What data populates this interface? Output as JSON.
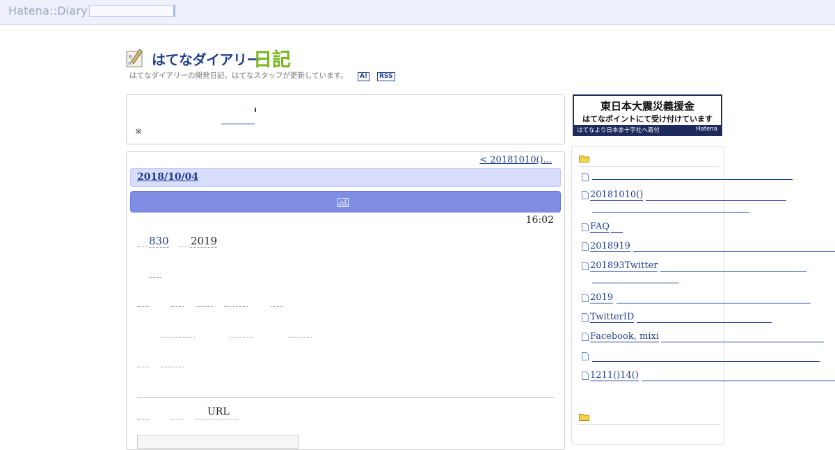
{
  "topbar": {
    "logo": "Hatena::Diary"
  },
  "header": {
    "title": "はてなダイアリー",
    "title_accent": "日記",
    "description": "はてなダイアリーの開発日記。はてなスタッフが更新しています。",
    "badge_a": "A!",
    "badge_rss": "RSS"
  },
  "notice": {
    "mark": "※"
  },
  "main": {
    "prev_link": "< 20181010()...",
    "date": "2018/10/04",
    "time": "16:02",
    "line1_num": "830",
    "line1_year": "2019",
    "url_label": "URL"
  },
  "banner": {
    "line1": "東日本大震災義援金",
    "line2": "はてなポイントにて受け付けています",
    "footer_left": "はてなより日本赤十字社へ寄付",
    "footer_right": "Hatena"
  },
  "sidebar": {
    "items": [
      {
        "label": ""
      },
      {
        "label": "20181010()"
      },
      {
        "label": "FAQ"
      },
      {
        "label": "2018919"
      },
      {
        "label": "201893Twitter"
      },
      {
        "label": "2019"
      },
      {
        "label": "TwitterID"
      },
      {
        "label": "Facebook, mixi"
      },
      {
        "label": ""
      },
      {
        "label": "1211()14()"
      }
    ]
  },
  "colors": {
    "accent": "#1f3f8f",
    "brand_green": "#77b51a",
    "date_bar": "#d7ddfa",
    "title_bar": "#7f8ee4"
  }
}
